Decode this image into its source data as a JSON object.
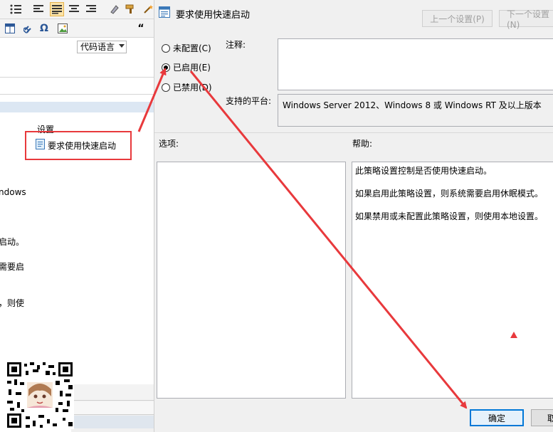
{
  "background": {
    "toolbar": {
      "code_language": "代码语言"
    },
    "settings_panel": {
      "heading": "设置",
      "item_label": "要求使用快速启动"
    },
    "fragments": [
      "ndows",
      "启动。",
      "需要启",
      "，则使"
    ]
  },
  "dialog": {
    "title": "要求使用快速启动",
    "prev_button": "上一个设置(P)",
    "next_button": "下一个设置(N)",
    "radio_not_configured": "未配置(C)",
    "radio_enabled": "已启用(E)",
    "radio_disabled": "已禁用(D)",
    "selected_radio": "enabled",
    "comment_label": "注释:",
    "platform_label": "支持的平台:",
    "platform_value": "Windows Server 2012、Windows 8 或 Windows RT 及以上版本",
    "options_label": "选项:",
    "help_label": "帮助:",
    "help_lines": [
      "此策略设置控制是否使用快速启动。",
      "如果启用此策略设置，则系统需要启用休眠模式。",
      "如果禁用或未配置此策略设置，则使用本地设置。"
    ],
    "ok_button": "确定",
    "cancel_button": "取"
  },
  "colors": {
    "annotation_red": "#e8393c",
    "accent_blue": "#0078d7"
  }
}
